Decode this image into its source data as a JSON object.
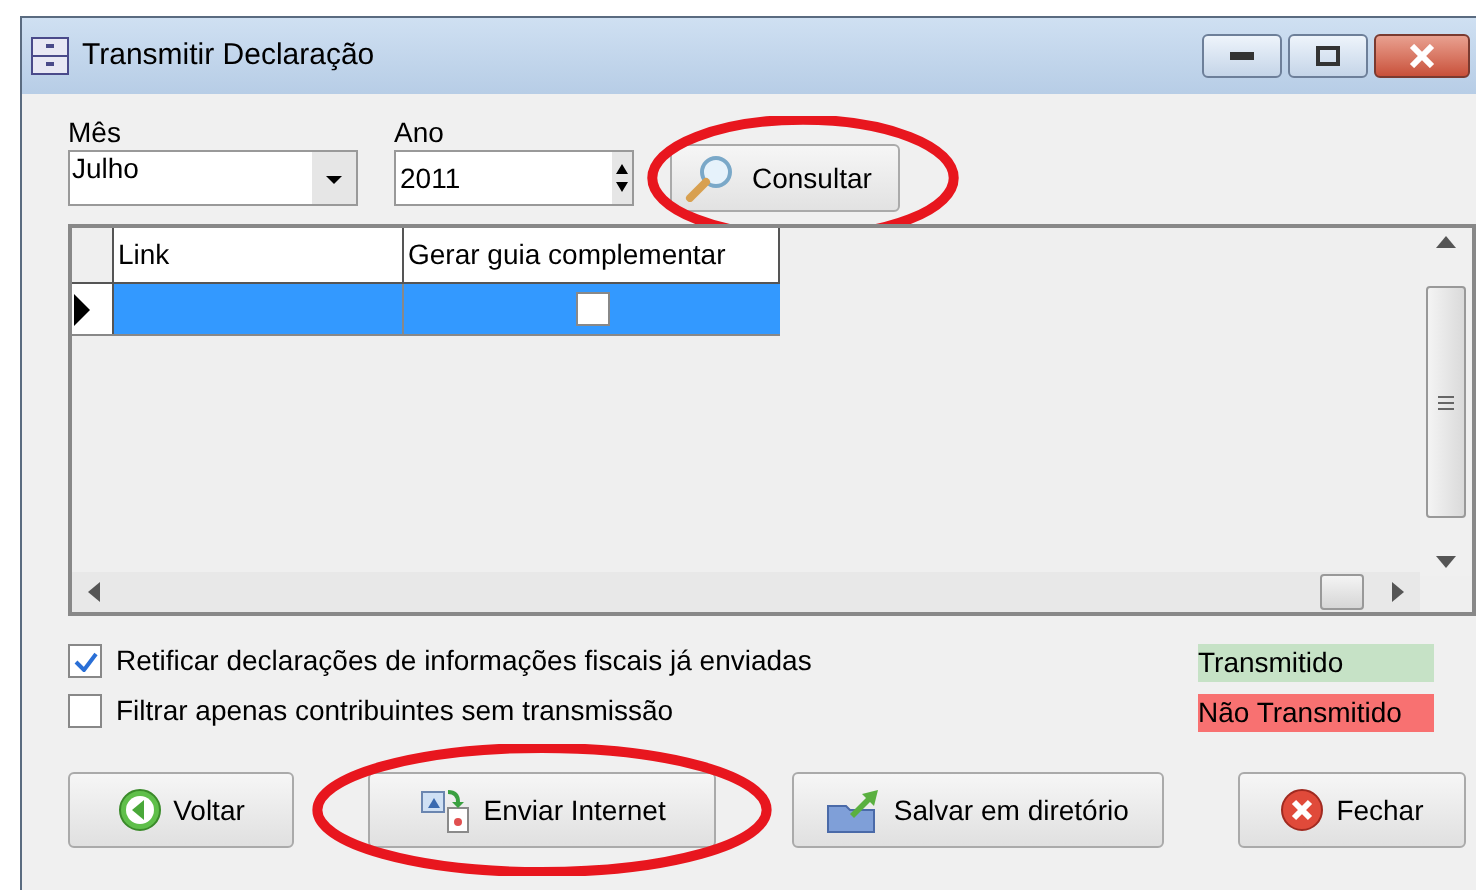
{
  "window": {
    "title": "Transmitir Declaração"
  },
  "filters": {
    "month": {
      "label": "Mês",
      "value": "Julho"
    },
    "year": {
      "label": "Ano",
      "value": "2011"
    }
  },
  "search_button": {
    "label": "Consultar",
    "circled": true
  },
  "grid": {
    "columns": [
      "Link",
      "Gerar guia complementar"
    ],
    "rows": [
      {
        "link": "",
        "generate": false,
        "selected": true
      }
    ]
  },
  "options": [
    {
      "label": "Retificar declarações de informações fiscais já enviadas",
      "checked": true
    },
    {
      "label": "Filtrar apenas contribuintes sem transmissão",
      "checked": false
    }
  ],
  "legend": [
    {
      "label": "Transmitido",
      "color": "#c6e2c6"
    },
    {
      "label": "Não Transmitido",
      "color": "#f87171"
    }
  ],
  "buttons": [
    {
      "kind": "back",
      "label": "Voltar",
      "circled": false
    },
    {
      "kind": "send",
      "label": "Enviar Internet",
      "circled": true
    },
    {
      "kind": "save",
      "label": "Salvar em diretório",
      "circled": false
    },
    {
      "kind": "close",
      "label": "Fechar",
      "circled": false
    }
  ]
}
